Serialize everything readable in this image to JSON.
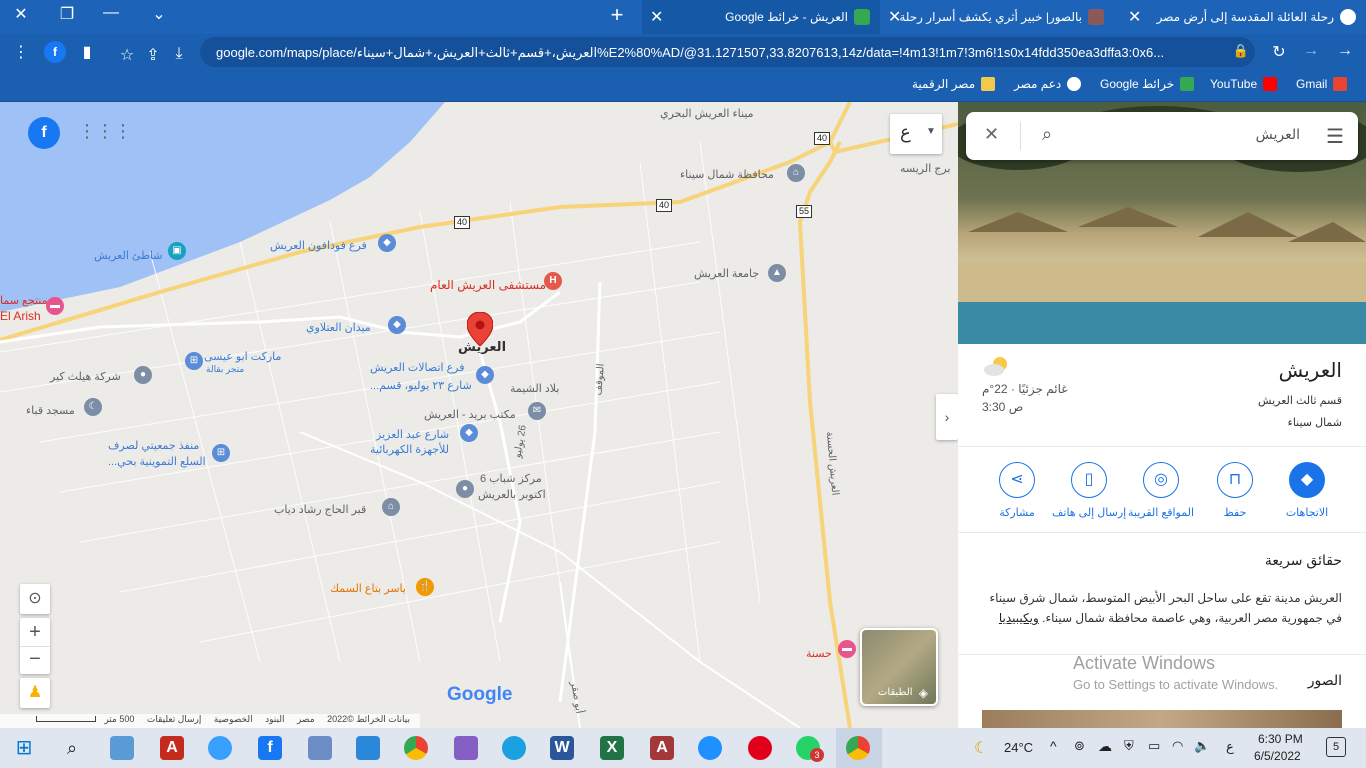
{
  "browser": {
    "tabs": [
      {
        "title": "رحلة العائلة المقدسة إلى أرض مصر",
        "active": false
      },
      {
        "title": "بالصور| خبير أثري يكشف أسرار رحلة",
        "active": false
      },
      {
        "title": "العريش - خرائط Google",
        "active": true
      }
    ],
    "url": "google.com/maps/place/العريش،+قسم+ثالث+العريش،+شمال+سيناء%E2%80%AD/@31.1271507,33.8207613,14z/data=!4m13!1m7!3m6!1s0x14fdd350ea3dffa3:0x6..."
  },
  "bookmarks": [
    {
      "label": "Gmail",
      "color": "#ea4335"
    },
    {
      "label": "YouTube",
      "color": "#ff0000"
    },
    {
      "label": "خرائط Google",
      "color": "#34a853"
    },
    {
      "label": "دعم مصر",
      "color": "#ffffff"
    },
    {
      "label": "مصر الرقمية",
      "color": "#f2c94c"
    }
  ],
  "map": {
    "layers_button_label": "الطبقات",
    "attribution": [
      "بيانات الخرائط ©2022",
      "مصر",
      "البنود",
      "الخصوصية",
      "إرسال تعليقات",
      "500 متر"
    ],
    "google_logo": "Google",
    "language_selector": "ع",
    "labels": {
      "port": "ميناء العريش البحري",
      "governorate": "محافظة شمال سيناء",
      "borg": "برج الريسه",
      "food_branch": "فرع فودافون العريش",
      "beach": "شاطئ العريش",
      "resort": "منتجع سما",
      "el_arish": "El Arish",
      "hospital": "مستشفى العريش العام",
      "university": "جامعة العريش",
      "square": "ميدان العتلاوي",
      "market": "ماركت ابو عيسى",
      "market_sub": "متجر بقالة",
      "company": "شركة هيلث كير",
      "telecom": "فرع اتصالات العريش",
      "telecom_sub": "شارع ٢٣ يوليو، قسم...",
      "mosque": "مسجد قباء",
      "bilad": "بلاد الشيمة",
      "post": "مكتب بريد - العريش",
      "abdelaziz": "شارع عبد العزيز",
      "abdelaziz_sub": "للأجهزة الكهربائية",
      "outlet": "منفذ جمعيتي لصرف",
      "outlet_sub": "السلع التموينية بحي...",
      "youth": "مركز شباب 6",
      "youth_sub": "اكتوبر بالعريش",
      "tomb": "قبر الحاج رشاد دياب",
      "fish": "ياسر بتاع السمك",
      "hasna": "حسنة",
      "selected": "العريش",
      "street_26": "26 يوليو",
      "road_mawqif": "الموقف",
      "road_east": "العريش الحسنة",
      "road_abu": "أبو صقر"
    },
    "shields": [
      "40",
      "40",
      "40",
      "55"
    ]
  },
  "panel": {
    "search_value": "العريش",
    "place_name": "العريش",
    "address_line1": "قسم ثالث العريش",
    "address_line2": "شمال سيناء",
    "weather": "غائم جزئيًا · 22°م",
    "time": "3:30 ص",
    "actions": [
      {
        "label": "الاتجاهات",
        "icon": "directions-icon"
      },
      {
        "label": "حفظ",
        "icon": "bookmark-icon"
      },
      {
        "label": "المواقع القريبة",
        "icon": "nearby-icon"
      },
      {
        "label": "إرسال إلى هاتف",
        "icon": "send-to-phone-icon"
      },
      {
        "label": "مشاركة",
        "icon": "share-icon"
      }
    ],
    "quick_facts_title": "حقائق سريعة",
    "quick_facts_text": "العريش مدينة تقع على ساحل البحر الأبيض المتوسط، شمال شرق سيناء في جمهورية مصر العربية، وهي عاصمة محافظة شمال سيناء.",
    "wiki_link": "ويكيبيديا",
    "photos_title": "الصور",
    "activate_title": "Activate Windows",
    "activate_sub": "Go to Settings to activate Windows."
  },
  "taskbar": {
    "temperature": "24°C",
    "lang": "ع",
    "time": "6:30 PM",
    "date": "6/5/2022",
    "notifications": "5",
    "whatsapp_badge": "3"
  }
}
